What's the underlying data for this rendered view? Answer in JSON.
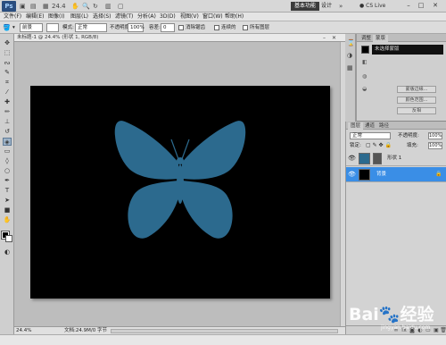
{
  "titlebar": {
    "app_icon": "Ps",
    "zoom_value": "24.4",
    "workspace_active": "基本功能",
    "workspace_other": "设计",
    "cs_live": "CS Live"
  },
  "menu": [
    "文件(F)",
    "编辑(E)",
    "图像(I)",
    "图层(L)",
    "选择(S)",
    "滤镜(T)",
    "分析(A)",
    "3D(D)",
    "视图(V)",
    "窗口(W)",
    "帮助(H)"
  ],
  "options": {
    "preset": "前景",
    "mode_label": "模式:",
    "mode_value": "正常",
    "opacity_label": "不透明度:",
    "opacity_value": "100%",
    "tolerance_label": "容差:",
    "tolerance_value": "0",
    "antialias": "消除锯齿",
    "contiguous": "连续的",
    "all_layers": "所有图层"
  },
  "document": {
    "tab_label": "未标题-1 @ 24.4% (形状 1, RGB/8)",
    "zoom": "24.4%",
    "doc_info": "文档:24.9M/0 字节",
    "canvas_color": "#000000",
    "butterfly_color": "#2c6a8e"
  },
  "adjustments": {
    "tabs": [
      "调整",
      "蒙版"
    ],
    "current": "未选择蒙版",
    "buttons": [
      "蒙版边缘...",
      "颜色范围...",
      "反相"
    ]
  },
  "layers": {
    "tabs": [
      "图层",
      "通道",
      "路径"
    ],
    "blend_mode": "正常",
    "opacity_label": "不透明度:",
    "opacity_value": "100%",
    "lock_label": "锁定:",
    "fill_label": "填充:",
    "fill_value": "100%",
    "items": [
      {
        "name": "形状 1",
        "thumb_color": "#2c6a8e",
        "selected": false
      },
      {
        "name": "背景",
        "thumb_color": "#000000",
        "selected": true
      }
    ]
  },
  "watermark": {
    "brand": "Bai",
    "brand_cn": "经验",
    "sub": "jingyan.baidu.com"
  }
}
